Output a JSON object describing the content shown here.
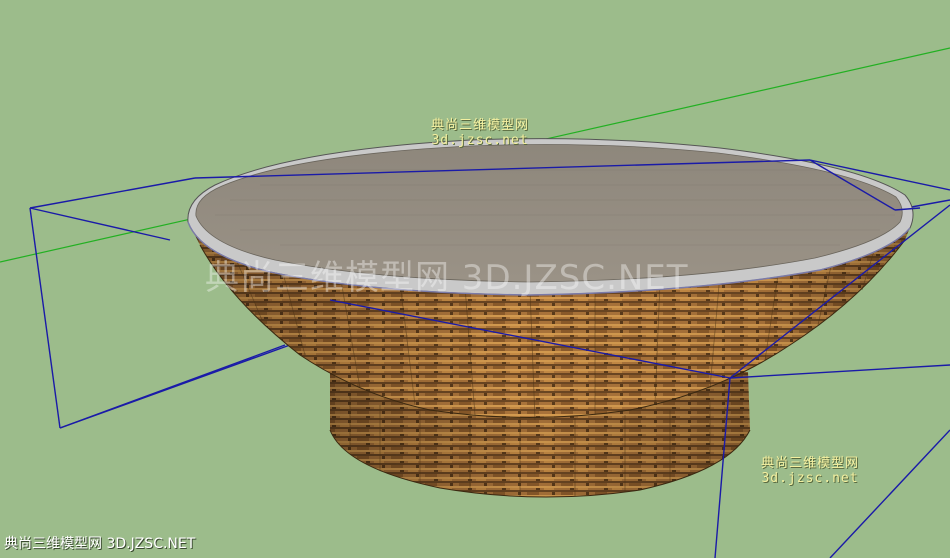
{
  "watermarks": {
    "top": {
      "line1": "典尚三维模型网",
      "line2": "3d.jzsc.net"
    },
    "center": "典尚三维模型网 3D.JZSC.NET",
    "right": {
      "line1": "典尚三维模型网",
      "line2": "3d.jzsc.net"
    },
    "bottom": "典尚三维模型网 3D.JZSC.NET"
  },
  "colors": {
    "background": "#9cbc8b",
    "axis_green": "#22b022",
    "bounding_box": "#1a1aa8",
    "wicker_dark": "#6b4a22",
    "wicker_light": "#c08840",
    "glass_top": "#8c8478"
  }
}
